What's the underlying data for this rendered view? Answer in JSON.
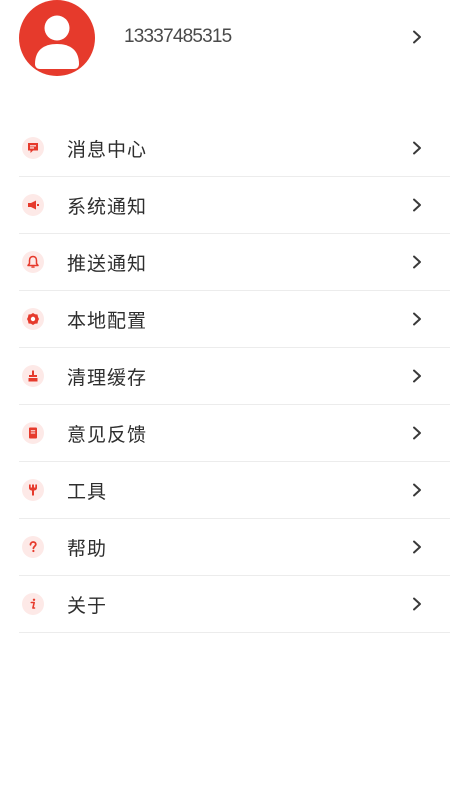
{
  "profile": {
    "phone": "13337485315",
    "avatar_icon": "user-avatar-icon"
  },
  "colors": {
    "accent": "#e63a2c",
    "icon_bg": "#fde9e7",
    "divider": "#ececec"
  },
  "menu": [
    {
      "label": "消息中心",
      "icon": "message-icon"
    },
    {
      "label": "系统通知",
      "icon": "megaphone-icon"
    },
    {
      "label": "推送通知",
      "icon": "bell-icon"
    },
    {
      "label": "本地配置",
      "icon": "gear-icon"
    },
    {
      "label": "清理缓存",
      "icon": "broom-icon"
    },
    {
      "label": "意见反馈",
      "icon": "document-icon"
    },
    {
      "label": "工具",
      "icon": "wrench-icon"
    },
    {
      "label": "帮助",
      "icon": "question-icon"
    },
    {
      "label": "关于",
      "icon": "info-icon"
    }
  ]
}
